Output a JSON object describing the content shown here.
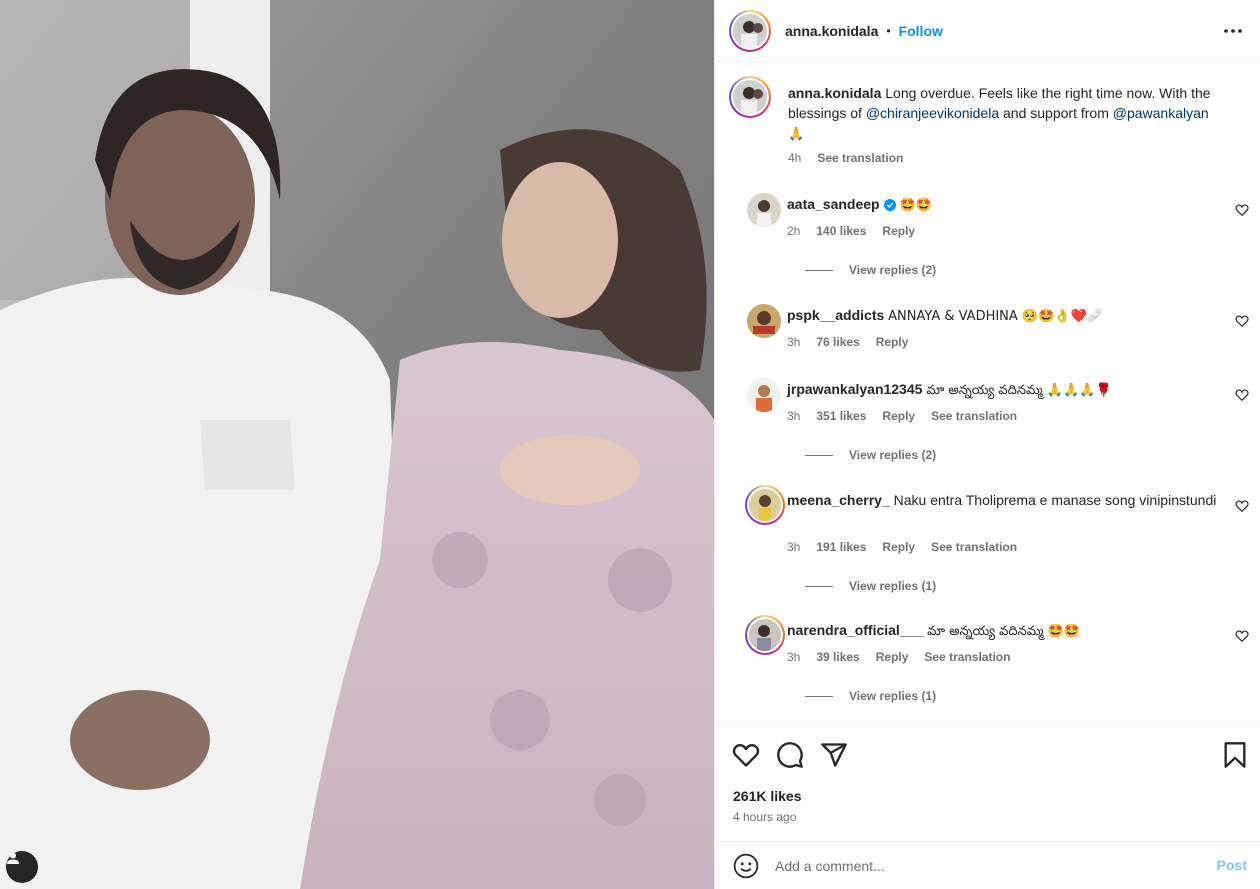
{
  "post": {
    "author": "anna.konidala",
    "dot": "•",
    "follow_label": "Follow",
    "caption_text": "Long overdue. Feels like the right time now. With the blessings of",
    "caption_mention1": "@chiranjeevikonidela",
    "caption_mid": "and support from",
    "caption_mention2": "@pawankalyan",
    "caption_emoji": "🙏",
    "caption_time": "4h",
    "see_translation": "See translation",
    "likes": "261K likes",
    "time_ago": "4 hours ago"
  },
  "comments": [
    {
      "user": "aata_sandeep",
      "verified": true,
      "text": "🤩🤩",
      "time": "2h",
      "likes": "140 likes",
      "reply": "Reply",
      "translation": "",
      "view_replies": "View replies (2)"
    },
    {
      "user": "pspk__addicts",
      "verified": false,
      "text": "ANNAYA & VADHINA 🥺🤩👌❤️🩹",
      "time": "3h",
      "likes": "76 likes",
      "reply": "Reply",
      "translation": "",
      "view_replies": ""
    },
    {
      "user": "jrpawankalyan12345",
      "verified": false,
      "text": "మా అన్నయ్య వదినమ్మ 🙏🙏🙏🌹",
      "time": "3h",
      "likes": "351 likes",
      "reply": "Reply",
      "translation": "See translation",
      "view_replies": "View replies (2)"
    },
    {
      "user": "meena_cherry_",
      "verified": false,
      "text": "Naku entra Tholiprema e manase song vinipinstundi",
      "time": "3h",
      "likes": "191 likes",
      "reply": "Reply",
      "translation": "See translation",
      "view_replies": "View replies (1)"
    },
    {
      "user": "narendra_official___",
      "verified": false,
      "text": "మా అన్నయ్య వదినమ్మ 🤩🤩",
      "time": "3h",
      "likes": "39 likes",
      "reply": "Reply",
      "translation": "See translation",
      "view_replies": "View replies (1)"
    }
  ],
  "comment_box": {
    "placeholder": "Add a comment...",
    "post_label": "Post"
  },
  "icons": {
    "more": "more-horizontal-icon",
    "like": "heart-icon",
    "comment": "comment-icon",
    "share": "share-icon",
    "save": "bookmark-icon",
    "emoji": "emoji-icon",
    "user_tag": "user-tag-icon",
    "verified": "verified-badge-icon"
  },
  "colors": {
    "link": "#0095f6",
    "mention": "#00376b",
    "muted": "#737373",
    "post_disabled": "#7fc6f9"
  }
}
